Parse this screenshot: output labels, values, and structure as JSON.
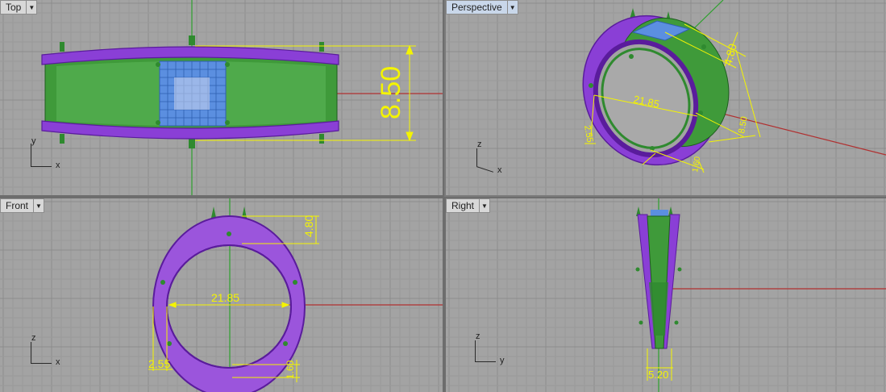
{
  "viewports": {
    "top": {
      "label": "Top",
      "axis_h": "x",
      "axis_v": "y"
    },
    "perspective": {
      "label": "Perspective",
      "axis_h": "x",
      "axis_v": "z"
    },
    "front": {
      "label": "Front",
      "axis_h": "x",
      "axis_v": "z"
    },
    "right": {
      "label": "Right",
      "axis_h": "y",
      "axis_v": "z"
    }
  },
  "dimensions": {
    "top_height": "8.50",
    "persp_band": "4.80",
    "persp_inner": "21.85",
    "persp_height": "8.50",
    "persp_thick": "2.55",
    "persp_bottom": "1.60",
    "front_band": "4.80",
    "front_inner": "21.85",
    "front_thick": "2.55",
    "front_bottom": "1.60",
    "right_width": "5.20"
  },
  "colors": {
    "viewport_bg": "#a3a3a3",
    "grid_line": "#9a9a9a",
    "grid_major": "#8c8c8c",
    "ring_purple": "#8a3fd6",
    "ring_green": "#2f8a2f",
    "setting_blue": "#5b8fe0",
    "dimension_yellow": "#f4f400",
    "axis_red": "#b03030",
    "axis_green": "#2ea02e",
    "active_tab": "#c9d7ea"
  }
}
